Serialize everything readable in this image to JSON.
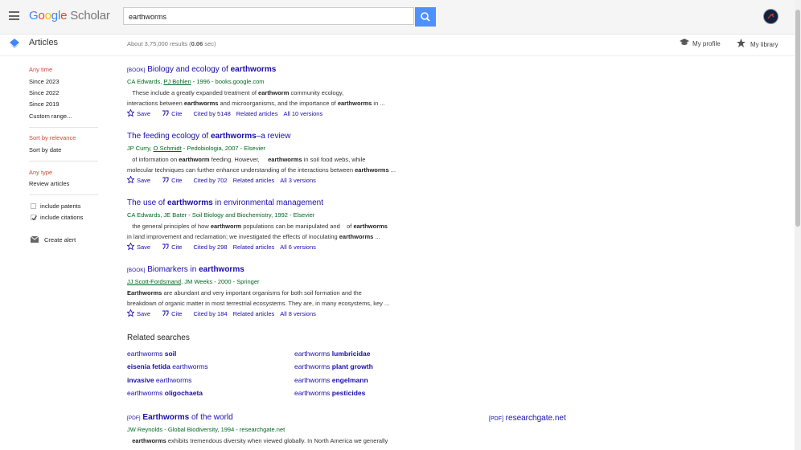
{
  "header": {
    "logo_letters": [
      "G",
      "o",
      "o",
      "g",
      "l",
      "e"
    ],
    "logo_suffix": "Scholar",
    "search_value": "earthworms"
  },
  "subbar": {
    "articles_label": "Articles",
    "stats_prefix": "About 3,75,000 results (",
    "stats_time": "0.06",
    "stats_suffix": " sec)",
    "my_profile": "My profile",
    "my_library": "My library"
  },
  "sidebar": {
    "time": [
      "Any time",
      "Since 2023",
      "Since 2022",
      "Since 2019",
      "Custom range..."
    ],
    "sort": [
      "Sort by relevance",
      "Sort by date"
    ],
    "type": [
      "Any type",
      "Review articles"
    ],
    "include_patents": "include patents",
    "include_citations": "include citations",
    "create_alert": "Create alert"
  },
  "results": [
    {
      "tag": "[BOOK]",
      "title_plain": "Biology and ecology of ",
      "title_bold": "earthworms",
      "title_after": "",
      "author1": "CA Edwards",
      "author2": "PJ Bohlen",
      "source": " - 1996 - books.google.com",
      "snip1a": "These include a greatly expanded treatment of ",
      "snip1b": "earthworm",
      "snip1c": " community ecology,",
      "snip2a": "interactions between ",
      "snip2b": "earthworms",
      "snip2c": " and microorganisms, and the importance of ",
      "snip2d": "earthworms",
      "snip2e": " in ...",
      "save": "Save",
      "cite": "Cite",
      "cited": "Cited by 5148",
      "related": "Related articles",
      "versions": "All 10 versions"
    },
    {
      "tag": "",
      "title_plain": "The feeding ecology of ",
      "title_bold": "earthworms",
      "title_after": "–a review",
      "author1": "JP Curry",
      "author2": "O Schmidt",
      "source": " - Pedobiologia, 2007 - Elsevier",
      "snip1a": "of information on ",
      "snip1b": "earthworm",
      "snip1c": " feeding. However, ",
      "snip1d": "earthworms",
      "snip1e": " in soil food webs, while",
      "snip2a": "molecular techniques can further enhance understanding of the interactions between ",
      "snip2b": "earthworms",
      "snip2c": " ...",
      "save": "Save",
      "cite": "Cite",
      "cited": "Cited by 702",
      "related": "Related articles",
      "versions": "All 3 versions"
    },
    {
      "tag": "",
      "title_plain": "The use of ",
      "title_bold": "earthworms",
      "title_after": " in environmental management",
      "author1": "CA Edwards, JE Bater",
      "source": " - Soil Biology and Biochemistry, 1992 - Elsevier",
      "snip1a": "the general principles of how ",
      "snip1b": "earthworm",
      "snip1c": " populations can be manipulated and ",
      "snip1d": "of ",
      "snip1e": "earthworms",
      "snip2a": "in land improvement and reclamation; we investigated the effects of inoculating ",
      "snip2b": "earthworms",
      "snip2c": " ...",
      "save": "Save",
      "cite": "Cite",
      "cited": "Cited by 298",
      "related": "Related articles",
      "versions": "All 6 versions"
    },
    {
      "tag": "[BOOK]",
      "title_plain": "Biomarkers in ",
      "title_bold": "earthworms",
      "title_after": "",
      "author1": "JJ Scott-Fordsmand",
      "author2": ", JM Weeks",
      "source": " - 2000 - Springer",
      "snip1a": "Earthworms",
      "snip1b": " are abundant and very important organisms for both soil formation and the",
      "snip2a": "breakdown of organic matter in most terrestrial ecosystems. They are, in many ecosystems, key ...",
      "save": "Save",
      "cite": "Cite",
      "cited": "Cited by 184",
      "related": "Related articles",
      "versions": "All 8 versions"
    }
  ],
  "related_searches": {
    "heading": "Related searches",
    "left": [
      {
        "plain": "earthworms ",
        "bold": "soil",
        "order": "pb"
      },
      {
        "plain": " earthworms",
        "bold": "eisenia fetida",
        "order": "bp"
      },
      {
        "plain": " earthworms",
        "bold": "invasive",
        "order": "bp"
      },
      {
        "plain": "earthworms ",
        "bold": "oligochaeta",
        "order": "pb"
      }
    ],
    "right": [
      {
        "plain": "earthworms ",
        "bold": "lumbricidae",
        "order": "pb"
      },
      {
        "plain": "earthworms ",
        "bold": "plant growth",
        "order": "pb"
      },
      {
        "plain": "earthworms ",
        "bold": "engelmann",
        "order": "pb"
      },
      {
        "plain": "earthworms ",
        "bold": "pesticides",
        "order": "pb"
      }
    ]
  },
  "last_result": {
    "tag": "[PDF]",
    "title_bold": "Earthworms",
    "title_after": " of the world",
    "authors": "JW Reynolds - Global Biodiversity, 1994 - researchgate.net",
    "snip1a": "earthworms",
    "snip1b": " exhibits tremendous diversity when viewed globally. In North America we generally",
    "pdf_tag": "[PDF]",
    "pdf_site": "researchgate.net"
  },
  "colors": {
    "link": "#1a0dab",
    "green": "#006621",
    "red": "#d14836",
    "search_button": "#4d90fe"
  }
}
